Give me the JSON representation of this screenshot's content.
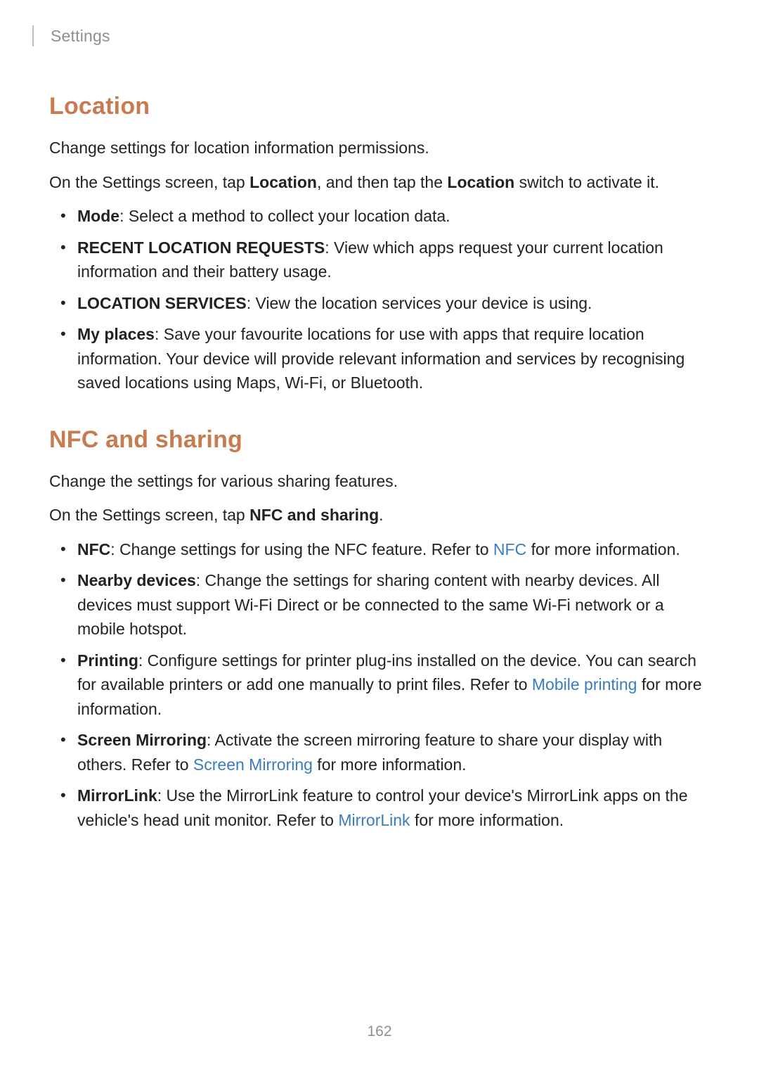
{
  "header": {
    "breadcrumb": "Settings"
  },
  "location": {
    "heading": "Location",
    "intro1": "Change settings for location information permissions.",
    "intro2_pre": "On the Settings screen, tap ",
    "intro2_b1": "Location",
    "intro2_mid": ", and then tap the ",
    "intro2_b2": "Location",
    "intro2_post": " switch to activate it.",
    "items": [
      {
        "label": "Mode",
        "rest": ": Select a method to collect your location data."
      },
      {
        "label": "RECENT LOCATION REQUESTS",
        "rest": ": View which apps request your current location information and their battery usage."
      },
      {
        "label": "LOCATION SERVICES",
        "rest": ": View the location services your device is using."
      },
      {
        "label": "My places",
        "rest": ": Save your favourite locations for use with apps that require location information. Your device will provide relevant information and services by recognising saved locations using Maps, Wi-Fi, or Bluetooth."
      }
    ]
  },
  "nfc": {
    "heading": "NFC and sharing",
    "intro1": "Change the settings for various sharing features.",
    "intro2_pre": "On the Settings screen, tap ",
    "intro2_b1": "NFC and sharing",
    "intro2_post": ".",
    "items": {
      "i0": {
        "label": "NFC",
        "pre": ": Change settings for using the NFC feature. Refer to ",
        "link": "NFC",
        "post": " for more information."
      },
      "i1": {
        "label": "Nearby devices",
        "rest": ": Change the settings for sharing content with nearby devices. All devices must support Wi-Fi Direct or be connected to the same Wi-Fi network or a mobile hotspot."
      },
      "i2": {
        "label": "Printing",
        "pre": ": Configure settings for printer plug-ins installed on the device. You can search for available printers or add one manually to print files. Refer to ",
        "link": "Mobile printing",
        "post": " for more information."
      },
      "i3": {
        "label": "Screen Mirroring",
        "pre": ": Activate the screen mirroring feature to share your display with others. Refer to ",
        "link": "Screen Mirroring",
        "post": " for more information."
      },
      "i4": {
        "label": "MirrorLink",
        "pre": ": Use the MirrorLink feature to control your device's MirrorLink apps on the vehicle's head unit monitor. Refer to ",
        "link": "MirrorLink",
        "post": " for more information."
      }
    }
  },
  "page_number": "162"
}
